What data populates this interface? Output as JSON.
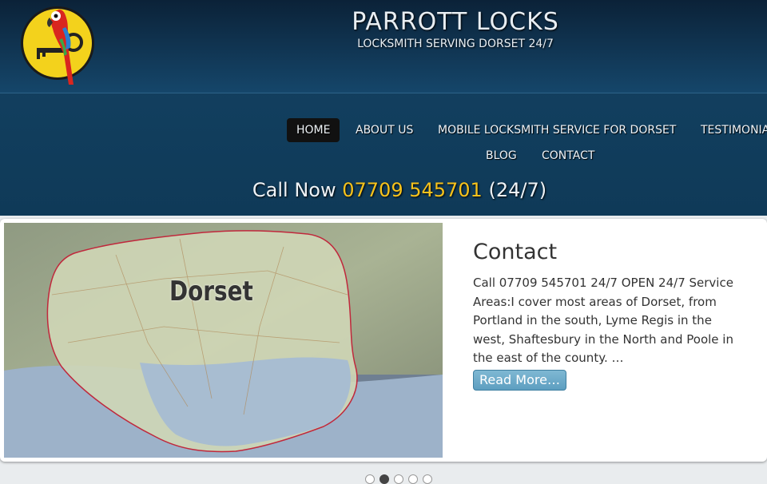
{
  "site": {
    "title": "PARROTT LOCKS",
    "tagline": "LOCKSMITH SERVING DORSET 24/7"
  },
  "nav": {
    "items": [
      {
        "label": "HOME",
        "active": true
      },
      {
        "label": "ABOUT US"
      },
      {
        "label": "MOBILE LOCKSMITH SERVICE FOR DORSET"
      },
      {
        "label": "TESTIMONIALS"
      },
      {
        "label": "BLOG"
      },
      {
        "label": "CONTACT"
      }
    ]
  },
  "callnow": {
    "prefix": "Call Now",
    "phone": "07709 545701",
    "suffix": "(24/7)"
  },
  "slide": {
    "map_label": "Dorset",
    "title": "Contact",
    "text": "Call 07709 545701 24/7 OPEN 24/7 Service Areas:I cover most areas of Dorset, from Portland in the south, Lyme Regis in the west, Shaftesbury in the North and Poole in the east of the county. …",
    "read_more": "Read More…"
  },
  "slider_dots": {
    "count": 5,
    "active_index": 1
  },
  "colors": {
    "phone": "#f6c21c",
    "header": "#123f5f",
    "read_more": "#6aa9c8"
  }
}
